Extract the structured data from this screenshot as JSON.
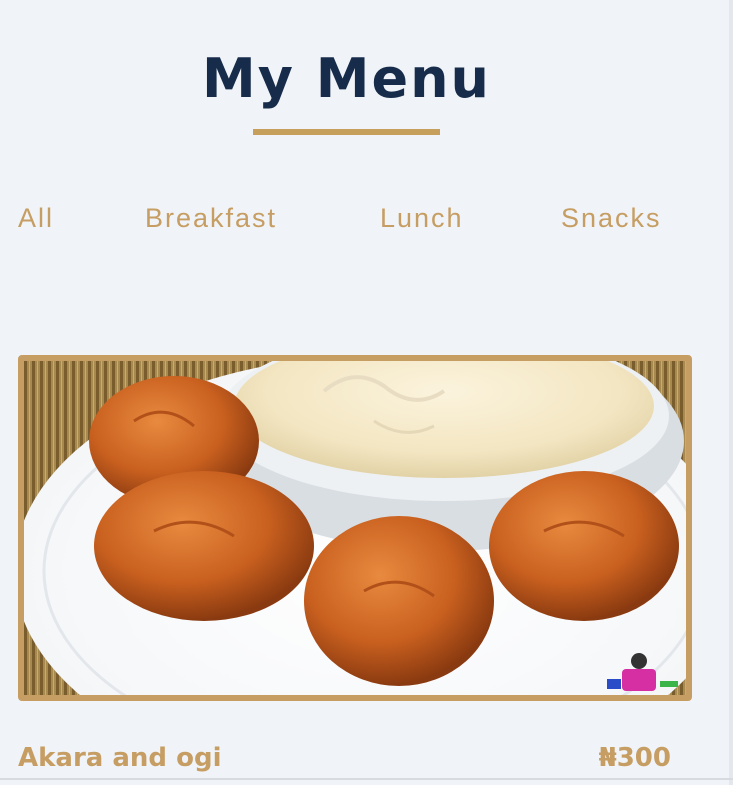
{
  "header": {
    "title": "My Menu"
  },
  "tabs": [
    {
      "label": "All"
    },
    {
      "label": "Breakfast"
    },
    {
      "label": "Lunch"
    },
    {
      "label": "Snacks"
    }
  ],
  "menu_items": [
    {
      "name": "Akara and ogi",
      "price": "₦300",
      "image": "akara-and-ogi-photo"
    }
  ],
  "colors": {
    "title": "#172b4a",
    "accent": "#c69d62",
    "background": "#f0f3f7"
  }
}
